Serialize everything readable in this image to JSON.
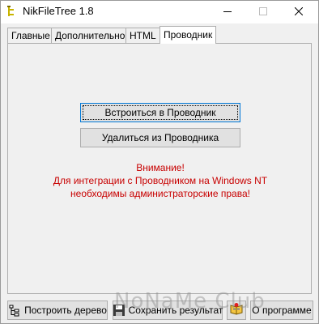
{
  "window": {
    "title": "NikFileTree 1.8",
    "app_icon": "folder-tree-icon",
    "minimize_icon": "minimize-icon",
    "maximize_icon": "maximize-icon",
    "close_icon": "close-icon"
  },
  "tabs": [
    {
      "label": "Главные",
      "active": false
    },
    {
      "label": "Дополнительно",
      "active": false
    },
    {
      "label": "HTML",
      "active": false
    },
    {
      "label": "Проводник",
      "active": true
    }
  ],
  "explorer": {
    "integrate_button": "Встроиться в Проводник",
    "remove_button": "Удалиться из Проводника",
    "warning_lines": [
      "Внимание!",
      "Для интеграции с Проводником на Windows NT",
      "необходимы администраторские права!"
    ],
    "warning_color": "#c80000"
  },
  "bottom_bar": {
    "build_tree_label": "Построить дерево",
    "build_tree_icon": "tree-icon",
    "save_result_label": "Сохранить результат",
    "save_result_icon": "floppy-disk-icon",
    "help_icon": "help-book-icon",
    "about_label": "О программе"
  },
  "watermark": "NoNaMe Club"
}
